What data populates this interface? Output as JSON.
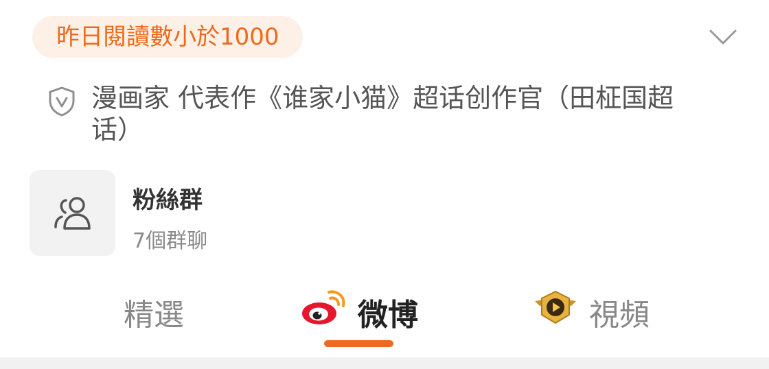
{
  "read_badge": "昨日閱讀數小於1000",
  "certification": {
    "icon": "shield-v-icon",
    "text": "漫画家 代表作《谁家小猫》超话创作官（田柾国超话）"
  },
  "fans_group": {
    "icon": "group-people-icon",
    "title": "粉絲群",
    "subtitle": "7個群聊"
  },
  "tabs": [
    {
      "label": "精選",
      "active": false
    },
    {
      "label": "微博",
      "active": true,
      "icon": "weibo-logo-icon"
    },
    {
      "label": "視頻",
      "active": false,
      "icon": "video-play-badge-icon"
    }
  ],
  "colors": {
    "accent": "#ef6a1f",
    "badge_background": "#fdf0e6",
    "muted_text": "#888888"
  }
}
